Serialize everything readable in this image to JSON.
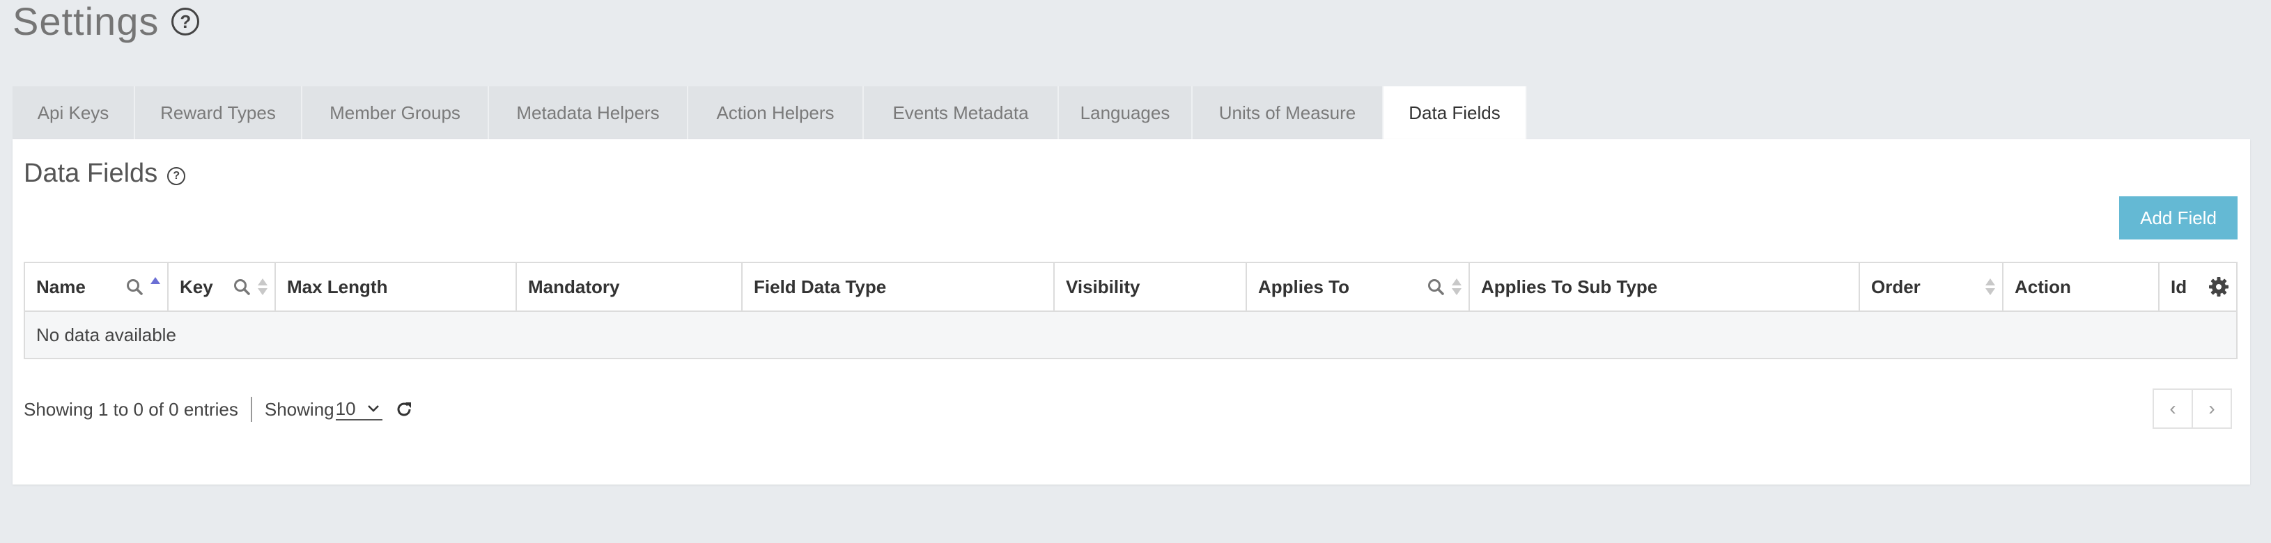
{
  "page": {
    "title": "Settings",
    "help_glyph": "?"
  },
  "tabs": [
    {
      "label": "Api Keys",
      "active": false
    },
    {
      "label": "Reward Types",
      "active": false
    },
    {
      "label": "Member Groups",
      "active": false
    },
    {
      "label": "Metadata Helpers",
      "active": false
    },
    {
      "label": "Action Helpers",
      "active": false
    },
    {
      "label": "Events Metadata",
      "active": false
    },
    {
      "label": "Languages",
      "active": false
    },
    {
      "label": "Units of Measure",
      "active": false
    },
    {
      "label": "Data Fields",
      "active": true
    }
  ],
  "section": {
    "title": "Data Fields",
    "help_glyph": "?"
  },
  "toolbar": {
    "add_label": "Add Field"
  },
  "table": {
    "columns": [
      {
        "label": "Name",
        "search": true,
        "sort": "asc"
      },
      {
        "label": "Key",
        "search": true,
        "sort": "both"
      },
      {
        "label": "Max Length"
      },
      {
        "label": "Mandatory"
      },
      {
        "label": "Field Data Type"
      },
      {
        "label": "Visibility"
      },
      {
        "label": "Applies To",
        "search": true,
        "sort": "both"
      },
      {
        "label": "Applies To Sub Type"
      },
      {
        "label": "Order",
        "sort": "both"
      },
      {
        "label": "Action"
      },
      {
        "label": "Id",
        "settings": true
      }
    ],
    "empty_message": "No data available"
  },
  "footer": {
    "info": "Showing 1 to 0 of 0 entries",
    "length_label": "Showing",
    "length_value": "10"
  },
  "pager": {
    "prev": "‹",
    "next": "›"
  },
  "colors": {
    "accent": "#64b9d4",
    "sort_active": "#6b6fd4",
    "background": "#e8ebee"
  },
  "icons": [
    "help-icon",
    "search-icon",
    "sort-icon",
    "gear-icon",
    "chevron-down-icon",
    "refresh-icon",
    "chevron-left-icon",
    "chevron-right-icon"
  ]
}
